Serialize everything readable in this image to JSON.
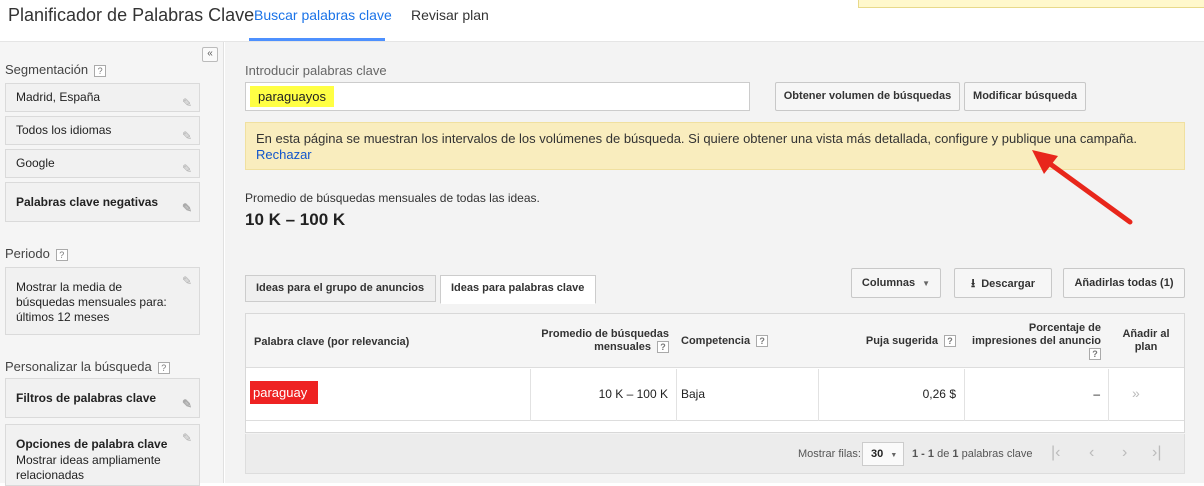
{
  "header": {
    "app_title": "Planificador de Palabras Clave",
    "tabs": [
      {
        "label": "Buscar palabras clave",
        "active": true
      },
      {
        "label": "Revisar plan",
        "active": false
      }
    ]
  },
  "sidebar": {
    "collapse_label": "«",
    "segmentation_title": "Segmentación",
    "segmentation_items": [
      "Madrid, España",
      "Todos los idiomas",
      "Google",
      "Palabras clave negativas"
    ],
    "period_title": "Periodo",
    "period_text": "Mostrar la media de búsquedas mensuales para: últimos 12 meses",
    "customize_title": "Personalizar la búsqueda",
    "filters_label": "Filtros de palabras clave",
    "options_title": "Opciones de palabra clave",
    "options_text": "Mostrar ideas ampliamente relacionadas"
  },
  "search": {
    "label": "Introducir palabras clave",
    "keyword": "paraguayos",
    "btn_volume": "Obtener volumen de búsquedas",
    "btn_modify": "Modificar búsqueda"
  },
  "notice": {
    "text": "En esta página se muestran los intervalos de los volúmenes de búsqueda. Si quiere obtener una vista más detallada, configure y publique una campaña.",
    "dismiss": "Rechazar"
  },
  "summary": {
    "label": "Promedio de búsquedas mensuales de todas las ideas.",
    "value": "10 K – 100 K"
  },
  "subtabs": [
    {
      "label": "Ideas para el grupo de anuncios",
      "active": false
    },
    {
      "label": "Ideas para palabras clave",
      "active": true
    }
  ],
  "toolbar": {
    "columns": "Columnas",
    "download": "Descargar",
    "add_all": "Añadirlas todas (1)"
  },
  "table": {
    "headers": {
      "keyword": "Palabra clave (por relevancia)",
      "avg_l1": "Promedio de búsquedas",
      "avg_l2": "mensuales",
      "competition": "Competencia",
      "bid": "Puja sugerida",
      "impr_l1": "Porcentaje de",
      "impr_l2": "impresiones del anuncio",
      "add_l1": "Añadir al",
      "add_l2": "plan"
    },
    "rows": [
      {
        "keyword": "paraguay",
        "avg": "10 K – 100 K",
        "competition": "Baja",
        "bid": "0,26 $",
        "impressions": "–",
        "add": "»"
      }
    ]
  },
  "footer": {
    "rows_label": "Mostrar filas:",
    "rows_value": "30",
    "range_bold": "1 - 1",
    "range_of": "de",
    "range_total": "1",
    "range_suffix": "palabras clave"
  },
  "colors": {
    "accent": "#4d90fe",
    "keyword_highlight": "#ffff44",
    "result_highlight": "#ee2222",
    "notice_bg": "#f9edbe",
    "arrow": "#e8261b"
  }
}
